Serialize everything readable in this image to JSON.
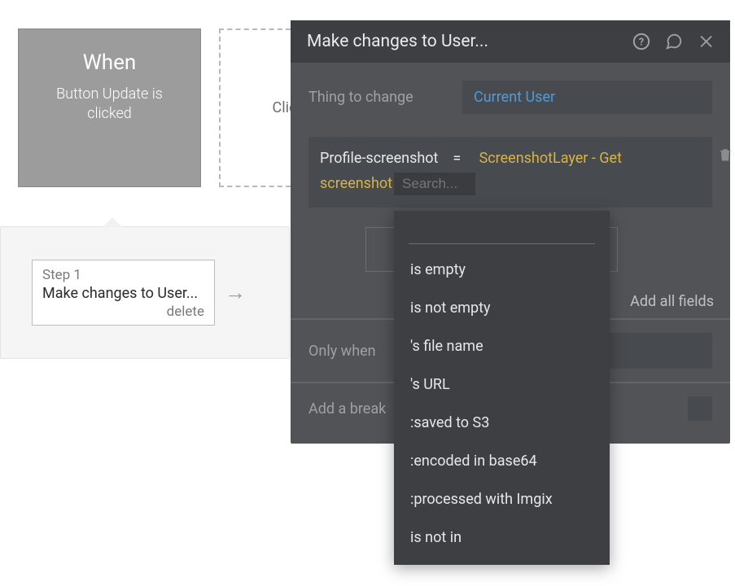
{
  "workflow": {
    "when": {
      "title": "When",
      "subtitle": "Button Update is clicked"
    },
    "placeholder": "Click",
    "step": {
      "label": "Step 1",
      "title": "Make changes to User...",
      "delete": "delete"
    }
  },
  "panel": {
    "title": "Make changes to User...",
    "thing_label": "Thing to change",
    "thing_value": "Current User",
    "expr": {
      "field": "Profile-screenshot",
      "equals": "=",
      "source_a": "ScreenshotLayer - Get",
      "source_b": "screenshot",
      "search_placeholder": "Search..."
    },
    "add_all_fields": "Add all fields",
    "only_when": "Only when",
    "add_break": "Add a break"
  },
  "dropdown": {
    "items": [
      "is empty",
      "is not empty",
      "'s file name",
      "'s URL",
      ":saved to S3",
      ":encoded in base64",
      ":processed with Imgix",
      "is not in"
    ]
  }
}
